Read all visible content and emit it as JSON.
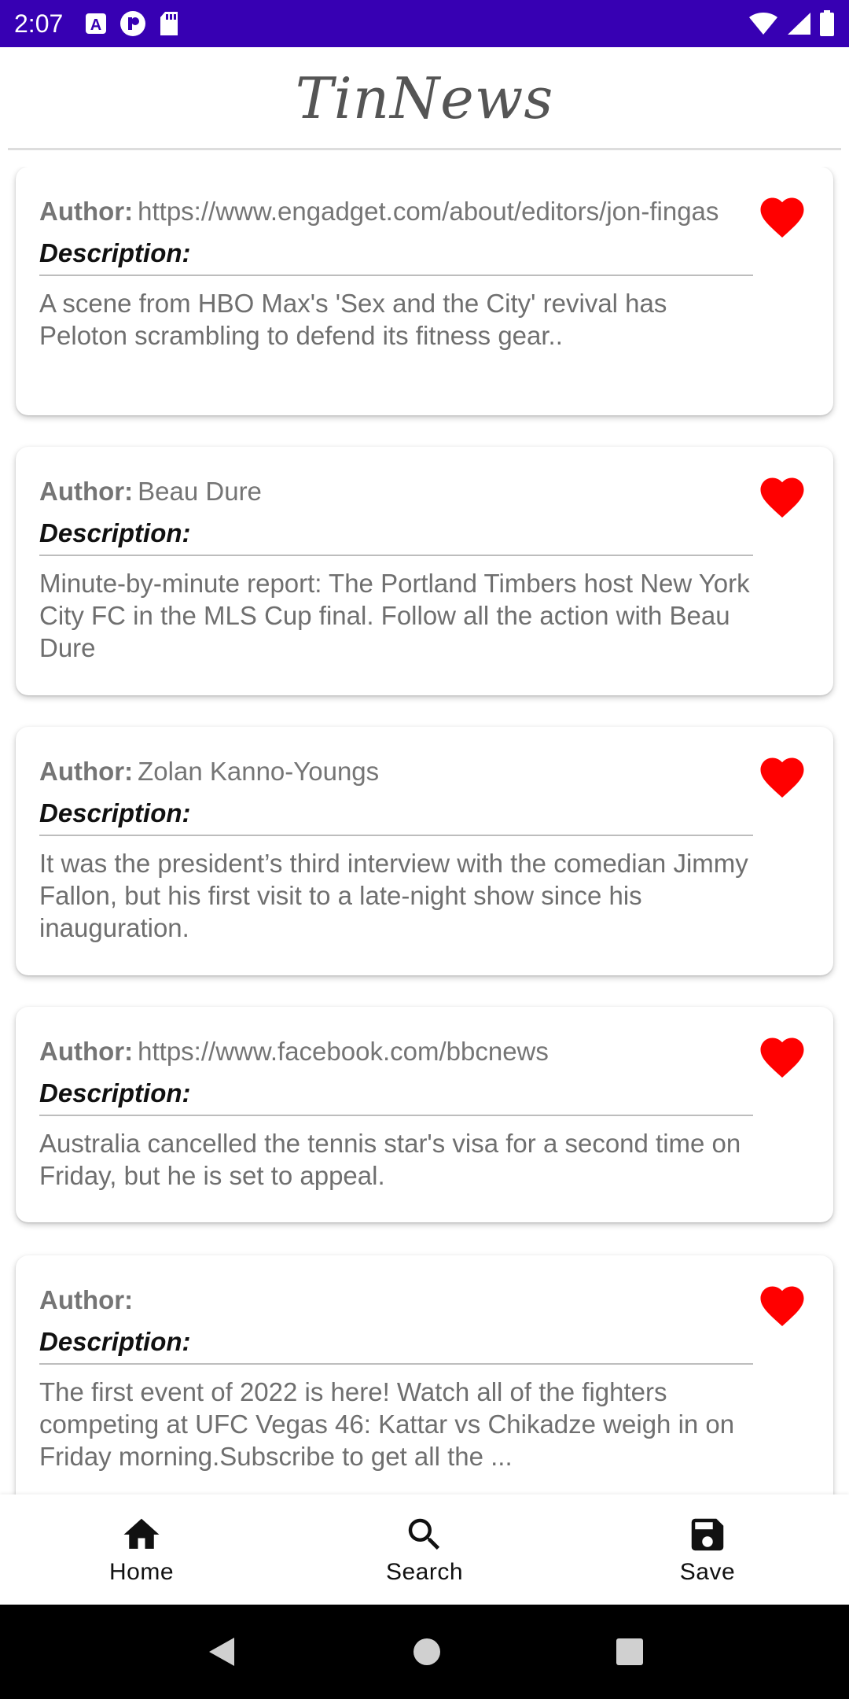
{
  "status_bar": {
    "time": "2:07",
    "icons": [
      "a-notification-icon",
      "media-icon",
      "sd-card-icon",
      "wifi-icon",
      "signal-icon",
      "battery-icon"
    ]
  },
  "app": {
    "title": "TinNews"
  },
  "articles": [
    {
      "author_label": "Author:",
      "author": "https://www.engadget.com/about/editors/jon-fingas",
      "description_label": "Description:",
      "description": "A scene from HBO Max's 'Sex and the City' revival has Peloton scrambling to defend its fitness gear.."
    },
    {
      "author_label": "Author:",
      "author": "Beau Dure",
      "description_label": "Description:",
      "description": "Minute-by-minute report: The Portland Timbers host New York City FC in the MLS Cup final. Follow all the action with Beau Dure"
    },
    {
      "author_label": "Author:",
      "author": "Zolan Kanno-Youngs",
      "description_label": "Description:",
      "description": "It was the president’s third interview with the comedian Jimmy Fallon, but his first visit to a late-night show since his inauguration."
    },
    {
      "author_label": "Author:",
      "author": "https://www.facebook.com/bbcnews",
      "description_label": "Description:",
      "description": "Australia cancelled the tennis star's visa for a second time on Friday, but he is set to appeal."
    },
    {
      "author_label": "Author:",
      "author": "",
      "description_label": "Description:",
      "description": "The first event of 2022 is here! Watch all of the fighters competing at UFC Vegas 46: Kattar vs Chikadze weigh in on Friday morning.Subscribe to get all the ..."
    }
  ],
  "bottom_nav": {
    "home": "Home",
    "search": "Search",
    "save": "Save"
  },
  "colors": {
    "status_bar": "#3700b3",
    "heart": "#ff0000",
    "title": "#555555"
  }
}
